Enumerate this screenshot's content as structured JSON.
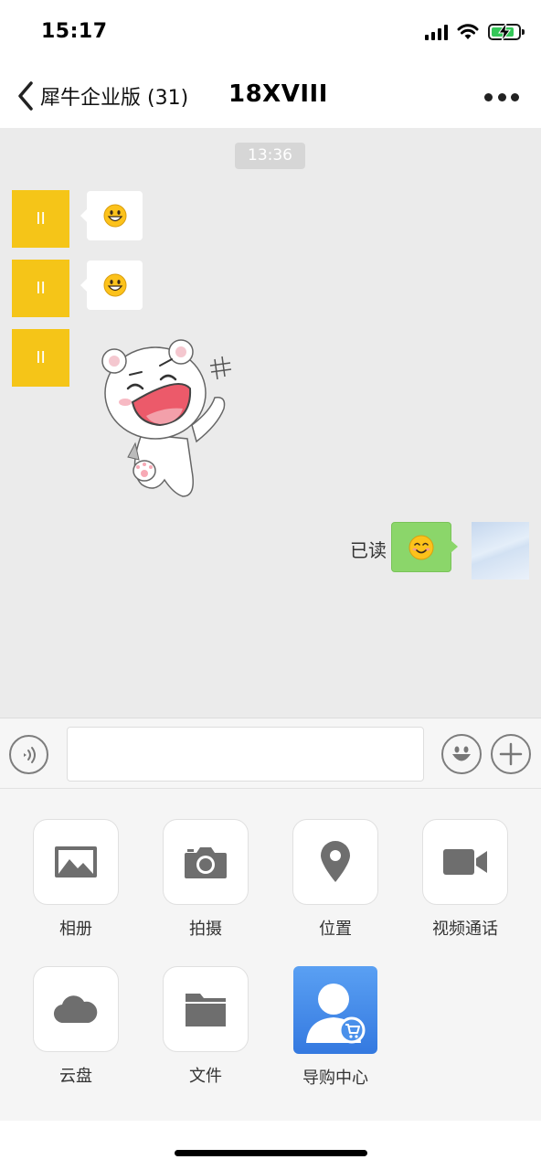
{
  "status_bar": {
    "time": "15:17"
  },
  "nav": {
    "back_label": "犀牛企业版 (31)",
    "title": "18XVIII"
  },
  "chat": {
    "time_stamp": "13:36",
    "avatar_text": "II",
    "read_status": "已读"
  },
  "input": {
    "placeholder": "",
    "value": ""
  },
  "actions": [
    {
      "label": "相册",
      "icon": "photo-icon"
    },
    {
      "label": "拍摄",
      "icon": "camera-icon"
    },
    {
      "label": "位置",
      "icon": "location-icon"
    },
    {
      "label": "视频通话",
      "icon": "video-call-icon"
    },
    {
      "label": "云盘",
      "icon": "cloud-icon"
    },
    {
      "label": "文件",
      "icon": "folder-icon"
    },
    {
      "label": "导购中心",
      "icon": "shopping-guide-app-icon"
    }
  ],
  "colors": {
    "chat_background": "#ebebeb",
    "avatar_yellow": "#f5c518",
    "sent_bubble_green": "#8bd66a",
    "battery_green": "#35c759"
  }
}
